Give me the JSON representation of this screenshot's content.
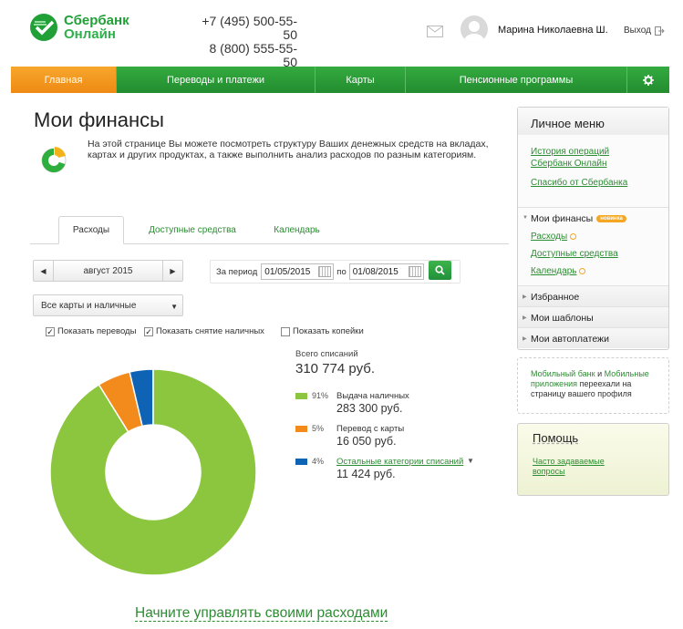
{
  "brand": {
    "line1": "Сбербанк",
    "line2": "Онлайн",
    "color": "#21a038"
  },
  "phones": [
    "+7 (495) 500-55-50",
    "8 (800) 555-55-50"
  ],
  "user": {
    "name": "Марина Николаевна Ш.",
    "logout": "Выход"
  },
  "nav": {
    "items": [
      "Главная",
      "Переводы и платежи",
      "Карты",
      "Пенсионные программы"
    ],
    "active": "Главная",
    "settings_icon": "gear-icon"
  },
  "page": {
    "title": "Мои финансы",
    "intro": "На этой странице Вы можете посмотреть структуру Ваших денежных средств на вкладах, картах и других продуктах, а также выполнить анализ расходов по разным категориям."
  },
  "tabs": [
    "Расходы",
    "Доступные средства",
    "Календарь"
  ],
  "filters": {
    "month": "август 2015",
    "period_label": "За период",
    "date_from": "01/05/2015",
    "to_label": "по",
    "date_to": "01/08/2015",
    "cards_select": "Все карты и наличные",
    "checkboxes": [
      {
        "label": "Показать переводы",
        "checked": true
      },
      {
        "label": "Показать снятие наличных",
        "checked": true
      },
      {
        "label": "Показать копейки",
        "checked": false
      }
    ]
  },
  "summary": {
    "label": "Всего списаний",
    "total": "310 774 руб."
  },
  "chart_data": {
    "type": "pie",
    "donut": true,
    "slices": [
      {
        "name": "Выдача наличных",
        "percent_label": "91%",
        "value": 283300,
        "amount": "283 300 руб.",
        "color": "#8cc63f"
      },
      {
        "name": "Перевод с карты",
        "percent_label": "5%",
        "value": 16050,
        "amount": "16 050 руб.",
        "color": "#f28a1c"
      },
      {
        "name": "Остальные категории списаний",
        "percent_label": "4%",
        "value": 11424,
        "amount": "11 424 руб.",
        "color": "#0e63b5"
      }
    ]
  },
  "cta": "Начните управлять своими расходами",
  "sidebar": {
    "title": "Личное меню",
    "links": [
      "История операций Сбербанк Онлайн",
      "Спасибо от Сбербанка"
    ],
    "finances": {
      "title": "Мои финансы",
      "badge": "новинка",
      "items": [
        "Расходы",
        "Доступные средства",
        "Календарь"
      ]
    },
    "rows": [
      "Избранное",
      "Мои шаблоны",
      "Мои автоплатежи"
    ]
  },
  "mobile_note": {
    "link1": "Мобильный банк",
    "and": "и",
    "link2": "Мобильные приложения",
    "rest": "переехали на страницу вашего профиля"
  },
  "help": {
    "title": "Помощь",
    "link": "Часто задаваемые вопросы"
  }
}
